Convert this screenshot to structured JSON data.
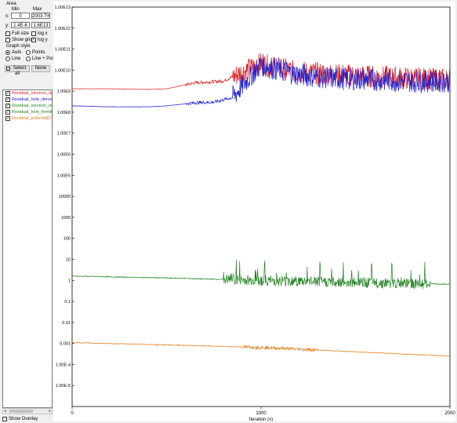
{
  "panel": {
    "area_label": "Area",
    "min_header": "Min",
    "max_header": "Max",
    "x_label": "x:",
    "x_min": "0",
    "x_max": "2003.7%",
    "y_label": "y:",
    "y_min": "1.4E-6",
    "y_max": "1.6E13",
    "checkboxes": [
      {
        "label": "Full size",
        "checked": false
      },
      {
        "label": "log x",
        "checked": false
      },
      {
        "label": "Show grid",
        "checked": false
      },
      {
        "label": "log y",
        "checked": true
      }
    ],
    "graph_style_label": "Graph style",
    "styles": [
      {
        "label": "Auto",
        "selected": true
      },
      {
        "label": "Points",
        "selected": false
      },
      {
        "label": "Line",
        "selected": false
      },
      {
        "label": "Line + Points",
        "selected": false
      }
    ],
    "select_all_label": "Select all",
    "none_label": "None",
    "series_items": [
      {
        "label": "Residual_electron_den",
        "color": "#e02020",
        "checked": true
      },
      {
        "label": "Residual_hole_density[",
        "color": "#2020d0",
        "checked": true
      },
      {
        "label": "Residual_electron_term",
        "color": "#208020",
        "checked": true
      },
      {
        "label": "Residual_hole_fermilev",
        "color": "#208020",
        "checked": true
      },
      {
        "label": "Residual_potential[V]",
        "color": "#e08020",
        "checked": true
      }
    ],
    "show_overlay_label": "Show Overlay"
  },
  "chart_data": {
    "type": "line",
    "xlabel": "Iteration (x)",
    "xlim": [
      0,
      2000
    ],
    "ylim": [
      1e-06,
      10000000000000.0
    ],
    "y_scale": "log",
    "x_ticks": [
      "0",
      "1000",
      "2000"
    ],
    "y_ticks": [
      "1.00E13",
      "1.00E12",
      "1.00E11",
      "1.00E10",
      "1.00E9",
      "1.00E8",
      "1.00E7",
      "1.00E6",
      "1.00E5",
      "10000",
      "1000",
      "100",
      "10",
      "1",
      "0.1",
      "0.01",
      "0.001",
      "1.00E-4",
      "1.00E-5"
    ],
    "series": [
      {
        "color": "#e02020",
        "x": [
          0,
          200,
          400,
          500,
          650,
          800,
          900,
          1000,
          1100,
          1200,
          1400,
          1600,
          1800,
          2000
        ],
        "y": [
          1300000000.0,
          1300000000.0,
          1200000000.0,
          1300000000.0,
          2500000000.0,
          3000000000.0,
          8000000000.0,
          20000000000.0,
          12000000000.0,
          8000000000.0,
          6000000000.0,
          5000000000.0,
          4000000000.0,
          3500000000.0
        ]
      },
      {
        "color": "#2020d0",
        "x": [
          0,
          200,
          400,
          500,
          650,
          750,
          850,
          950,
          1000,
          1100,
          1200,
          1400,
          1600,
          1800,
          2000
        ],
        "y": [
          200000000.0,
          180000000.0,
          180000000.0,
          200000000.0,
          280000000.0,
          300000000.0,
          500000000.0,
          6000000000.0,
          18000000000.0,
          10000000000.0,
          6000000000.0,
          4000000000.0,
          3500000000.0,
          3000000000.0,
          3000000000.0
        ]
      },
      {
        "color": "#208020",
        "x": [
          0,
          500,
          1000,
          1500,
          2000
        ],
        "y": [
          1.6,
          1.3,
          1.0,
          0.8,
          0.65
        ]
      },
      {
        "color": "#e08020",
        "x": [
          0,
          500,
          1000,
          1500,
          2000
        ],
        "y": [
          0.0011,
          0.00085,
          0.00065,
          0.0004,
          0.00025
        ]
      }
    ]
  }
}
